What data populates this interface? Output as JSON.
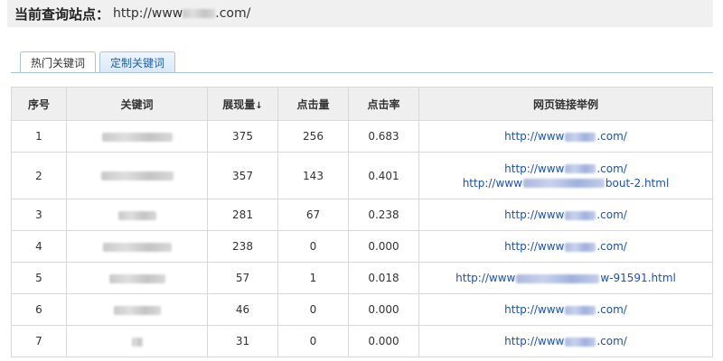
{
  "header": {
    "label": "当前查询站点：",
    "url_prefix": "http://www",
    "url_suffix": ".com/"
  },
  "tabs": [
    {
      "label": "热门关键词",
      "active": true
    },
    {
      "label": "定制关键词",
      "active": false
    }
  ],
  "table": {
    "columns": [
      "序号",
      "关键词",
      "展现量",
      "点击量",
      "点击率",
      "网页链接举例"
    ],
    "sort_indicator": "↓",
    "rows": [
      {
        "index": "1",
        "impressions": "375",
        "clicks": "256",
        "ctr": "0.683",
        "links": [
          {
            "prefix": "http://www",
            "suffix": ".com/"
          }
        ]
      },
      {
        "index": "2",
        "impressions": "357",
        "clicks": "143",
        "ctr": "0.401",
        "links": [
          {
            "prefix": "http://www",
            "suffix": ".com/"
          },
          {
            "prefix": "http://www",
            "suffix": "bout-2.html"
          }
        ]
      },
      {
        "index": "3",
        "impressions": "281",
        "clicks": "67",
        "ctr": "0.238",
        "links": [
          {
            "prefix": "http://www",
            "suffix": ".com/"
          }
        ]
      },
      {
        "index": "4",
        "impressions": "238",
        "clicks": "0",
        "ctr": "0.000",
        "links": [
          {
            "prefix": "http://www",
            "suffix": ".com/"
          }
        ]
      },
      {
        "index": "5",
        "impressions": "57",
        "clicks": "1",
        "ctr": "0.018",
        "links": [
          {
            "prefix": "http://www",
            "suffix": "w-91591.html"
          }
        ]
      },
      {
        "index": "6",
        "impressions": "46",
        "clicks": "0",
        "ctr": "0.000",
        "links": [
          {
            "prefix": "http://www",
            "suffix": ".com/"
          }
        ]
      },
      {
        "index": "7",
        "impressions": "31",
        "clicks": "0",
        "ctr": "0.000",
        "links": [
          {
            "prefix": "http://www",
            "suffix": ".com/"
          }
        ]
      }
    ]
  },
  "colors": {
    "link": "#1f4fb0",
    "header_bg": "#f0f0f0",
    "table_header_bg": "#efefef",
    "tab_border": "#a9c3de"
  }
}
